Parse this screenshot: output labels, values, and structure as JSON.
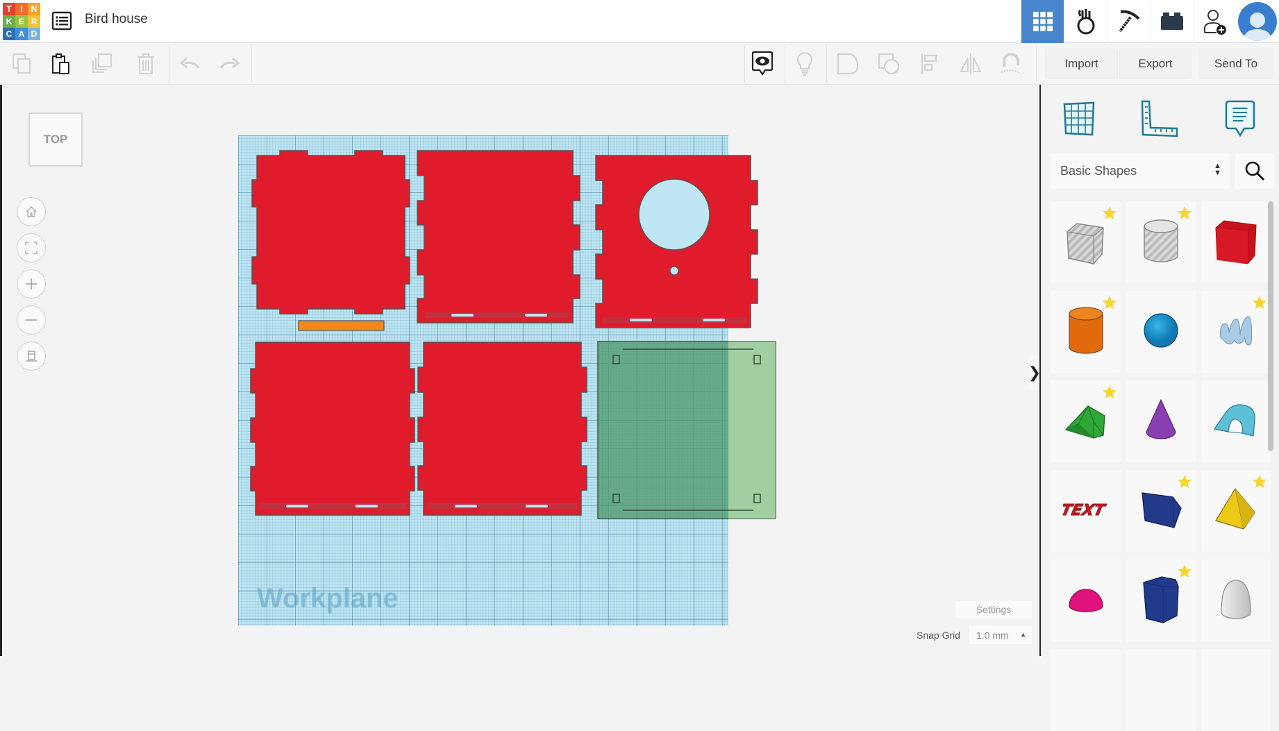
{
  "app": {
    "logo_letters": [
      "T",
      "I",
      "N",
      "K",
      "E",
      "R",
      "C",
      "A",
      "D"
    ],
    "logo_colors": [
      "#e8412d",
      "#f26c2b",
      "#f5a623",
      "#6ab04c",
      "#9bc53d",
      "#f2c23b",
      "#2e6fb4",
      "#3f8fd1",
      "#7fb3df"
    ],
    "design_title": "Bird house"
  },
  "top_right": {
    "items": [
      {
        "name": "3d-design-view",
        "icon": "grid-icon",
        "active": true
      },
      {
        "name": "circuits",
        "icon": "circuits-icon",
        "active": false
      },
      {
        "name": "minecraft-export",
        "icon": "pickaxe-icon",
        "active": false
      },
      {
        "name": "lego-bricks",
        "icon": "brick-icon",
        "active": false
      },
      {
        "name": "invite-user",
        "icon": "add-user-icon",
        "active": false
      },
      {
        "name": "profile",
        "icon": "avatar-icon",
        "active": false
      }
    ],
    "accent": "#4a86d0"
  },
  "toolbar": {
    "left_tools": [
      {
        "name": "copy",
        "icon": "copy-icon",
        "enabled": false
      },
      {
        "name": "paste",
        "icon": "paste-icon",
        "enabled": true
      },
      {
        "name": "duplicate",
        "icon": "duplicate-icon",
        "enabled": false
      },
      {
        "name": "delete",
        "icon": "trash-icon",
        "enabled": false
      },
      {
        "name": "undo",
        "icon": "undo-icon",
        "enabled": false
      },
      {
        "name": "redo",
        "icon": "redo-icon",
        "enabled": false
      }
    ],
    "right_tools": [
      {
        "name": "notes-toggle",
        "icon": "eye-note-icon",
        "enabled": true
      },
      {
        "name": "show-all",
        "icon": "lightbulb-icon",
        "enabled": false
      },
      {
        "name": "group",
        "icon": "group-icon",
        "enabled": false
      },
      {
        "name": "ungroup",
        "icon": "ungroup-icon",
        "enabled": false
      },
      {
        "name": "align",
        "icon": "align-icon",
        "enabled": false
      },
      {
        "name": "mirror",
        "icon": "mirror-icon",
        "enabled": false
      },
      {
        "name": "cruise",
        "icon": "magnet-icon",
        "enabled": false
      }
    ],
    "import_label": "Import",
    "export_label": "Export",
    "send_to_label": "Send To"
  },
  "viewport": {
    "view_cube_label": "TOP",
    "nav_buttons": [
      {
        "name": "home-view",
        "icon": "home-icon"
      },
      {
        "name": "fit-all",
        "icon": "fit-icon"
      },
      {
        "name": "zoom-in",
        "icon": "plus-icon"
      },
      {
        "name": "zoom-out",
        "icon": "minus-icon"
      },
      {
        "name": "ortho-toggle",
        "icon": "perspective-icon"
      }
    ],
    "workplane_label": "Workplane",
    "settings_label": "Settings",
    "snap_grid_label": "Snap Grid",
    "snap_grid_value": "1.0 mm",
    "collapse_label": "❯",
    "shape_color": "#e01b2b",
    "hole_color": "#bfe6f2",
    "strip_color": "#f08a1c",
    "selected_plate_color": "#4e9a6e"
  },
  "panel": {
    "tabs": [
      {
        "name": "workplane-tool",
        "icon": "workplane-grid-icon"
      },
      {
        "name": "ruler-tool",
        "icon": "ruler-icon"
      },
      {
        "name": "notes-tool",
        "icon": "note-icon"
      }
    ],
    "category": "Basic Shapes",
    "shapes": [
      {
        "name": "Box Hole",
        "starred": true
      },
      {
        "name": "Cylinder Hole",
        "starred": true
      },
      {
        "name": "Box",
        "starred": false
      },
      {
        "name": "Cylinder",
        "starred": true
      },
      {
        "name": "Sphere",
        "starred": false
      },
      {
        "name": "Scribble",
        "starred": true
      },
      {
        "name": "Roof",
        "starred": true
      },
      {
        "name": "Cone",
        "starred": false
      },
      {
        "name": "Round Roof",
        "starred": false
      },
      {
        "name": "Text",
        "starred": false
      },
      {
        "name": "Polygon",
        "starred": true
      },
      {
        "name": "Pyramid",
        "starred": true
      },
      {
        "name": "Half Sphere",
        "starred": false
      },
      {
        "name": "Polygon Prism",
        "starred": true
      },
      {
        "name": "Paraboloid",
        "starred": false
      }
    ],
    "text_shape_label": "TEXT"
  }
}
